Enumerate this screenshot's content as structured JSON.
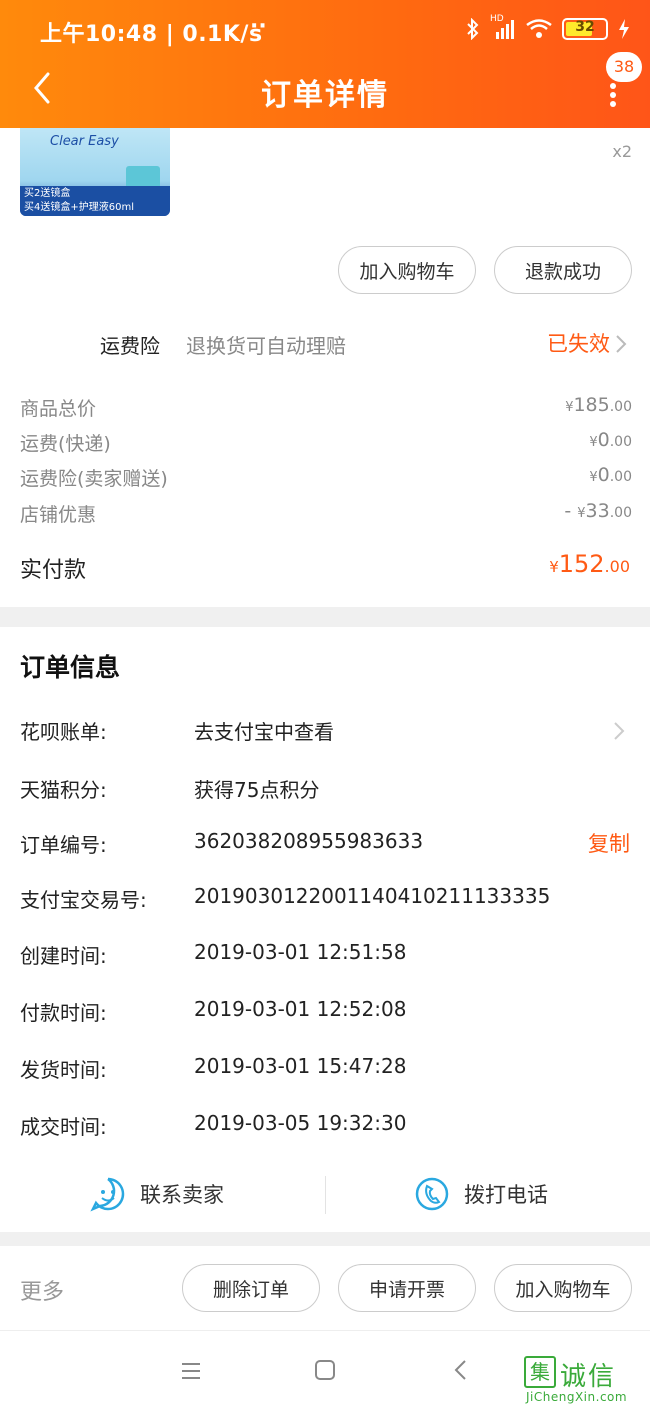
{
  "status_bar": {
    "left_text": "上午10:48 | 0.1K/s",
    "dots": "··",
    "network_label": "HD",
    "battery": "32"
  },
  "header": {
    "title": "订单详情",
    "badge_count": "38"
  },
  "product": {
    "brand": "Clear Easy",
    "promo_line1": "买2送镜盒",
    "promo_line2": "买4送镜盒+护理液60ml",
    "quantity": "x2",
    "buttons": {
      "add_cart": "加入购物车",
      "refund": "退款成功"
    }
  },
  "insurance": {
    "label": "运费险",
    "desc": "退换货可自动理赔",
    "status": "已失效"
  },
  "prices": [
    {
      "label": "商品总价",
      "sign": "",
      "yen": "¥",
      "int": "185",
      "dec": ".00"
    },
    {
      "label": "运费(快递)",
      "sign": "",
      "yen": "¥",
      "int": "0",
      "dec": ".00"
    },
    {
      "label": "运费险(卖家赠送)",
      "sign": "",
      "yen": "¥",
      "int": "0",
      "dec": ".00"
    },
    {
      "label": "店铺优惠",
      "sign": "- ",
      "yen": "¥",
      "int": "33",
      "dec": ".00"
    }
  ],
  "paid": {
    "label": "实付款",
    "yen": "¥",
    "int": "152",
    "dec": ".00"
  },
  "order_info": {
    "title": "订单信息",
    "rows": [
      {
        "key": "花呗账单:",
        "value": "去支付宝中查看"
      },
      {
        "key": "天猫积分:",
        "value": "获得75点积分"
      },
      {
        "key": "订单编号:",
        "value": "362038208955983633"
      },
      {
        "key": "支付宝交易号:",
        "value": "2019030122001140410211133335"
      },
      {
        "key": "创建时间:",
        "value": "2019-03-01 12:51:58"
      },
      {
        "key": "付款时间:",
        "value": "2019-03-01 12:52:08"
      },
      {
        "key": "发货时间:",
        "value": "2019-03-01 15:47:28"
      },
      {
        "key": "成交时间:",
        "value": "2019-03-05 19:32:30"
      }
    ],
    "copy_label": "复制"
  },
  "contact": {
    "seller": "联系卖家",
    "phone": "拨打电话"
  },
  "bottom_bar": {
    "more": "更多",
    "delete": "删除订单",
    "invoice": "申请开票",
    "add_cart": "加入购物车"
  },
  "watermark": {
    "box_char": "集",
    "cn": "诚信",
    "en": "JiChengXin.com"
  },
  "colors": {
    "header_start": "#ff8a0c",
    "header_end": "#ff5518",
    "accent": "#ff5a14",
    "contact_icon": "#2aa8e0"
  },
  "icons": [
    "back-arrow-icon",
    "more-menu-icon",
    "chevron-right-icon",
    "smiley-chat-icon",
    "phone-icon",
    "nav-menu-icon",
    "nav-home-icon",
    "nav-back-icon"
  ]
}
